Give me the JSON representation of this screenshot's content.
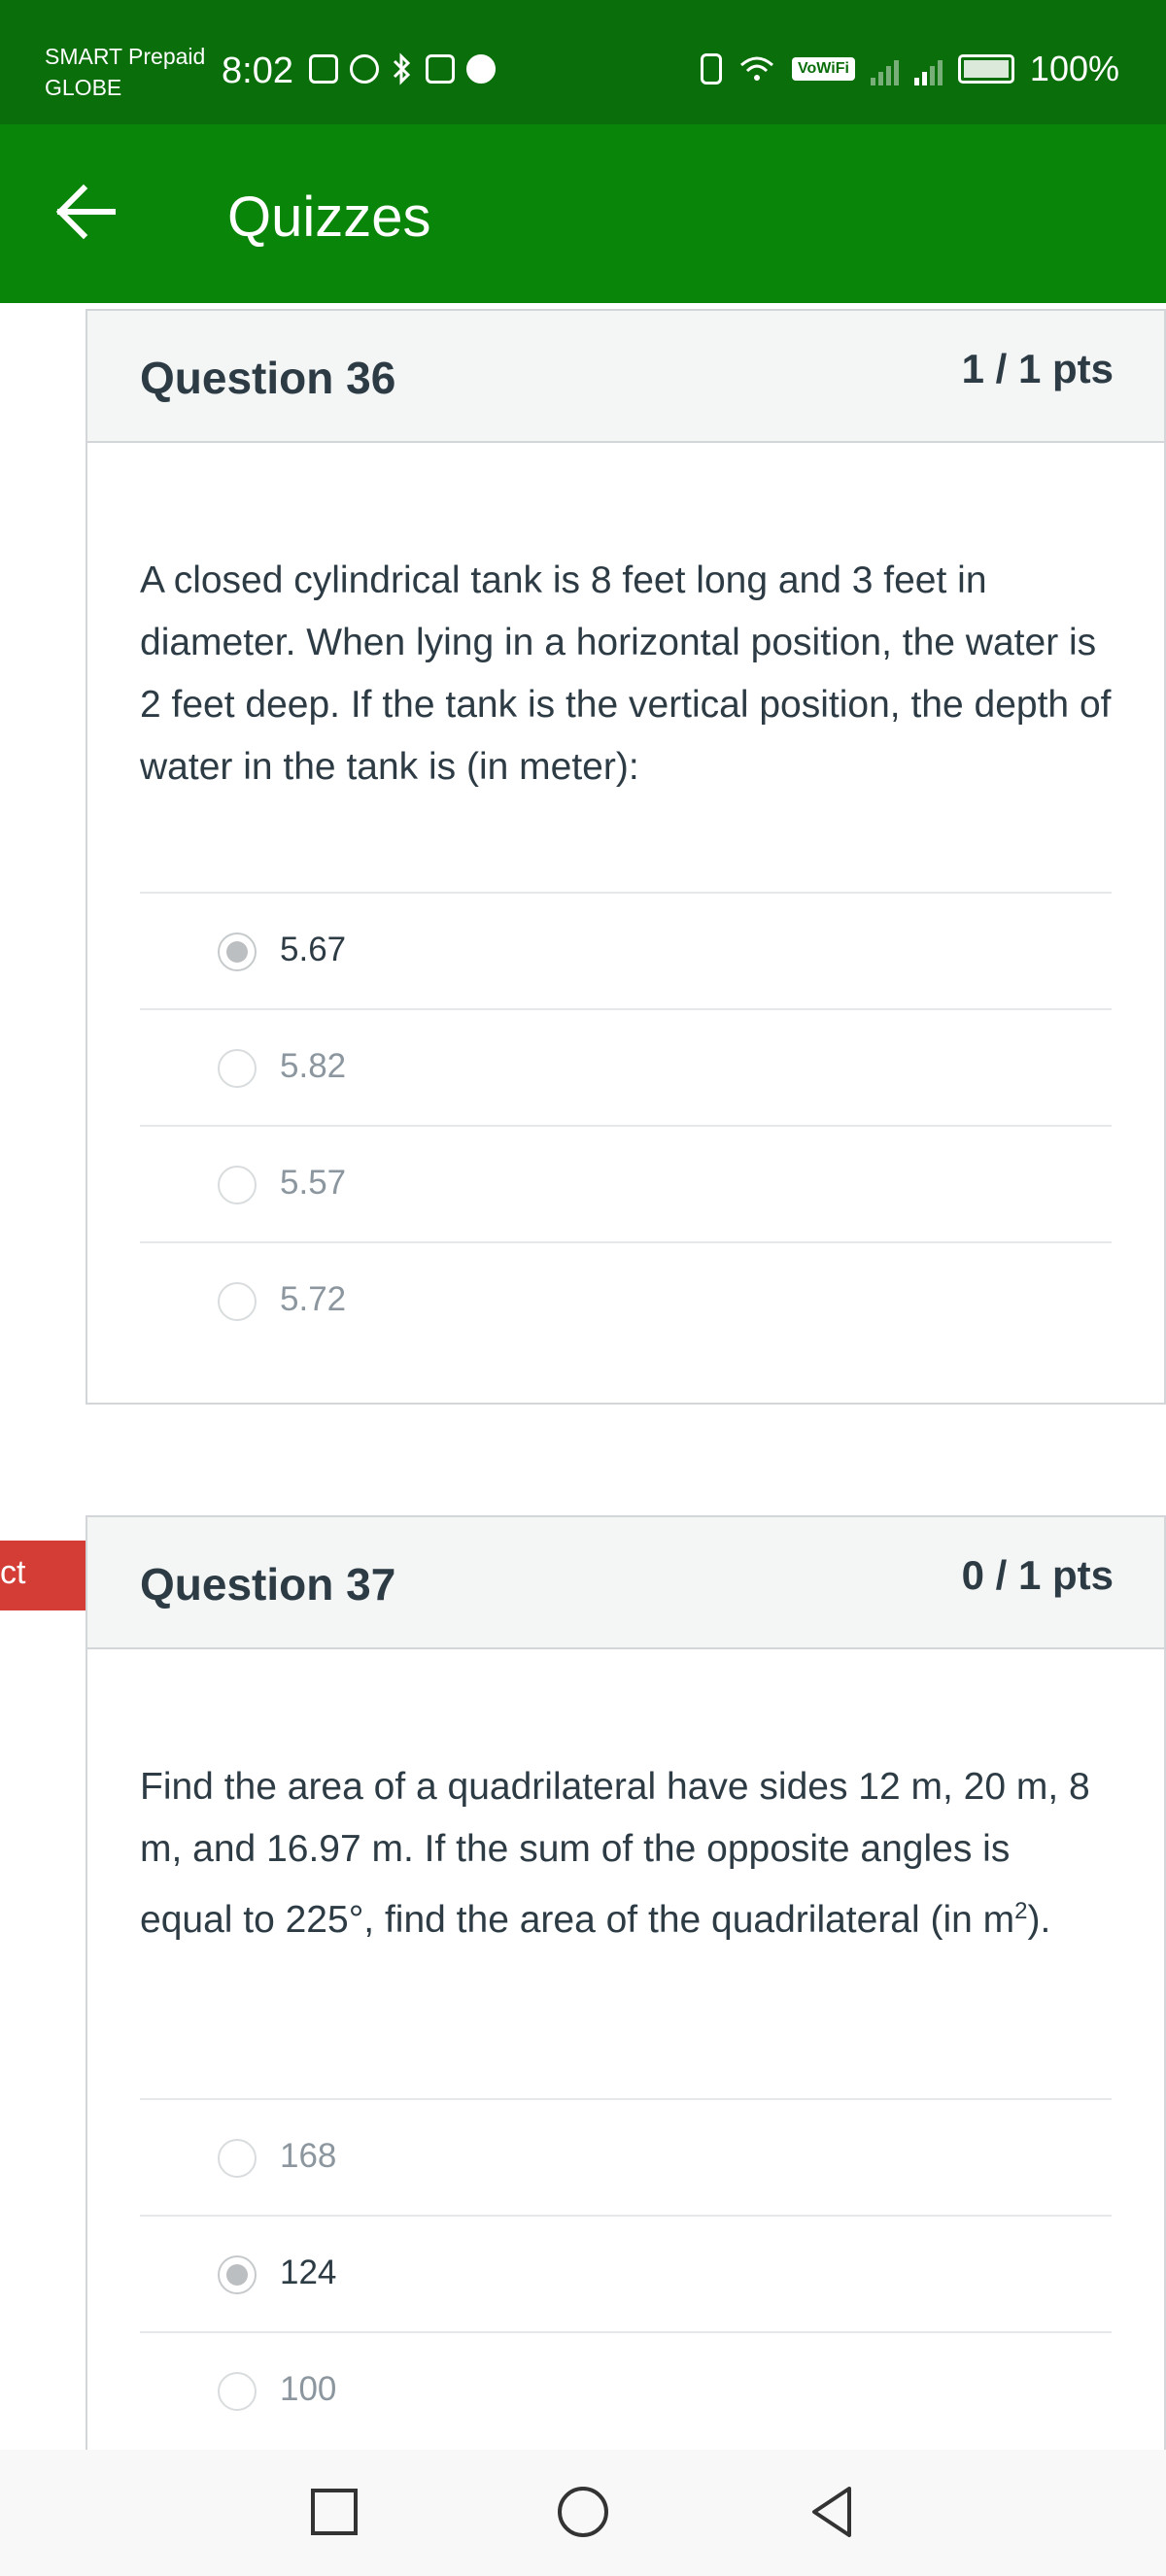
{
  "status_bar": {
    "carrier_line1": "SMART Prepaid",
    "carrier_line2": "GLOBE",
    "time": "8:02",
    "vowifi": "VoWiFi",
    "battery": "100%"
  },
  "app_bar": {
    "title": "Quizzes"
  },
  "questions": [
    {
      "title": "Question 36",
      "points": "1 / 1 pts",
      "text": "A closed cylindrical tank is 8 feet long and 3 feet in diameter. When lying in a horizontal position, the water is 2 feet deep. If the tank is the vertical position, the depth of water in the tank is (in meter):",
      "answers": [
        {
          "label": "5.67",
          "selected": true
        },
        {
          "label": "5.82",
          "selected": false
        },
        {
          "label": "5.57",
          "selected": false
        },
        {
          "label": "5.72",
          "selected": false
        }
      ]
    },
    {
      "title": "Question 37",
      "points": "0 / 1 pts",
      "text_main": "Find the area of a quadrilateral have sides 12 m, 20 m, 8 m, and 16.97 m. If the sum of the opposite angles is equal to 225°, find the area of the quadrilateral (in m",
      "text_sup": "2",
      "text_end": ").",
      "answers": [
        {
          "label": "168",
          "selected": false
        },
        {
          "label": "124",
          "selected": true
        },
        {
          "label": "100",
          "selected": false
        }
      ]
    }
  ],
  "incorrect_tag": "ct",
  "colors": {
    "status_bar": "#0a6e0a",
    "app_bar": "#098509",
    "incorrect": "#d43d36"
  }
}
